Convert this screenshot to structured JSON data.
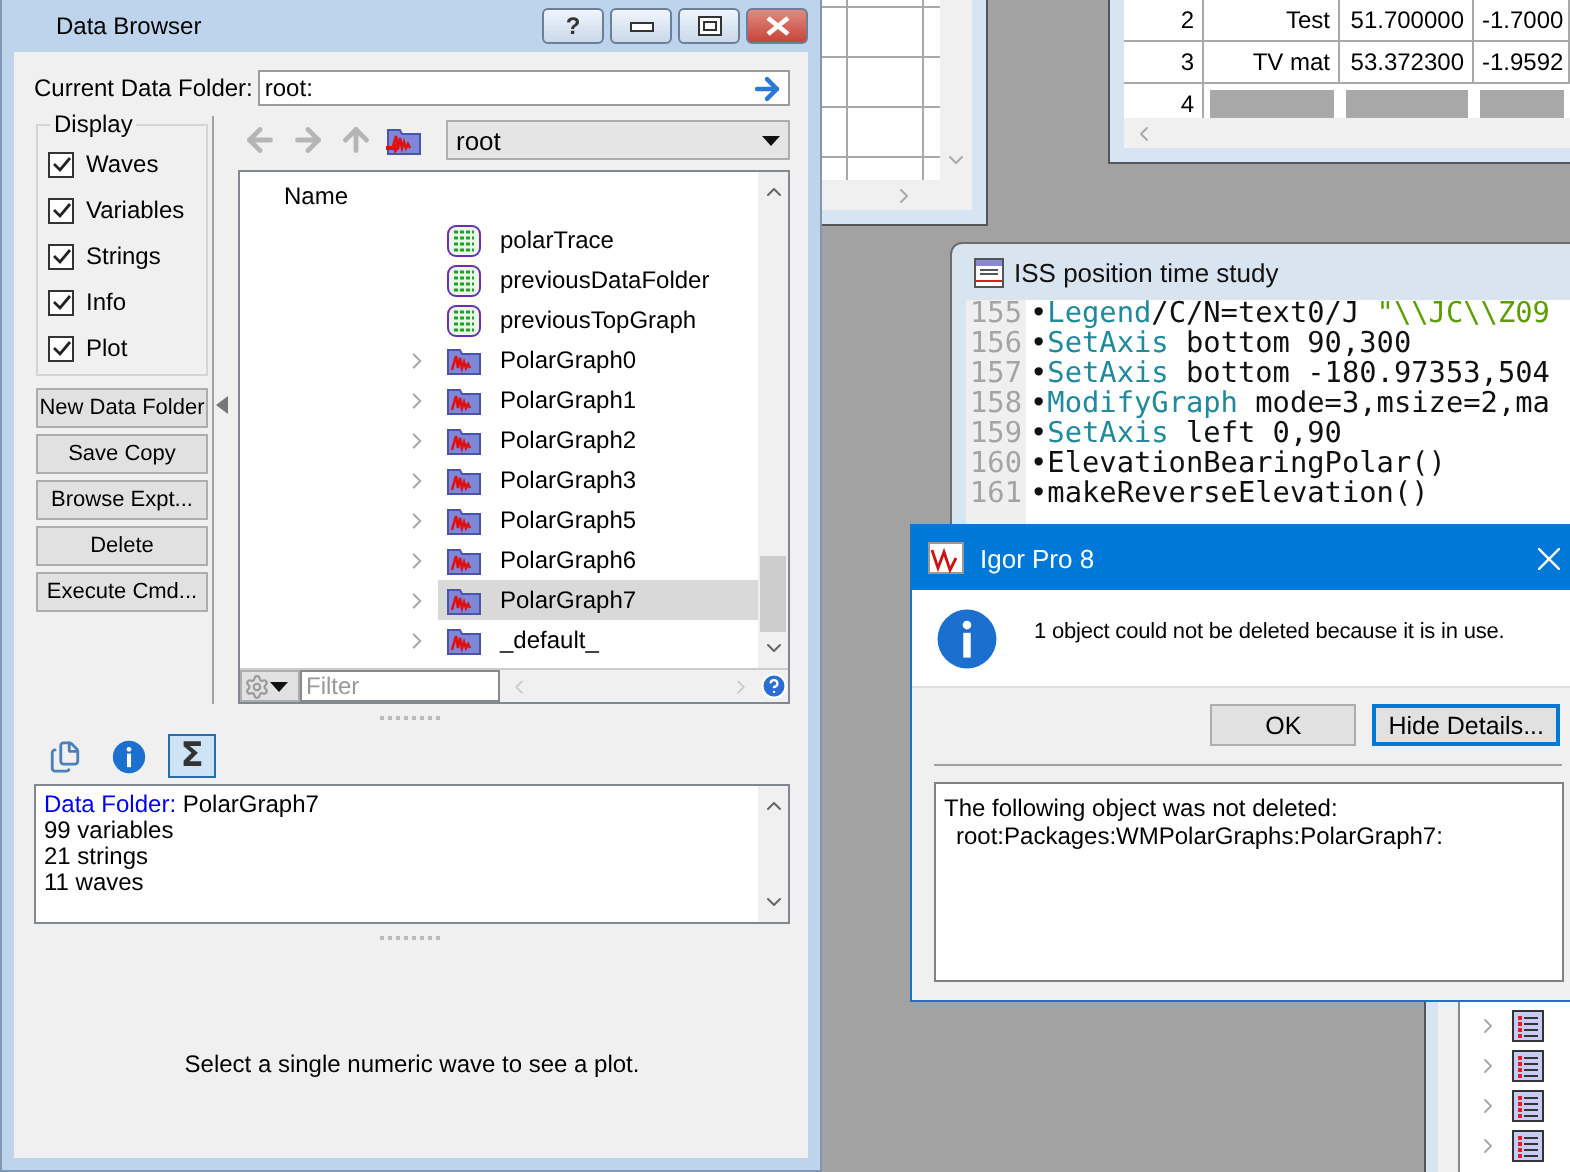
{
  "data_browser": {
    "title": "Data Browser",
    "help_label": "?",
    "folder_label": "Current Data Folder:",
    "folder_path": "root:",
    "display": {
      "title": "Display",
      "options": [
        {
          "label": "Waves",
          "checked": true
        },
        {
          "label": "Variables",
          "checked": true
        },
        {
          "label": "Strings",
          "checked": true
        },
        {
          "label": "Info",
          "checked": true
        },
        {
          "label": "Plot",
          "checked": true
        }
      ]
    },
    "buttons": [
      "New Data Folder",
      "Save Copy",
      "Browse Expt...",
      "Delete",
      "Execute Cmd..."
    ],
    "folder_menu": "root",
    "list": {
      "column": "Name",
      "items": [
        {
          "name": "polarTrace",
          "kind": "string",
          "selected": false
        },
        {
          "name": "previousDataFolder",
          "kind": "string",
          "selected": false
        },
        {
          "name": "previousTopGraph",
          "kind": "string",
          "selected": false
        },
        {
          "name": "PolarGraph0",
          "kind": "folder",
          "selected": false
        },
        {
          "name": "PolarGraph1",
          "kind": "folder",
          "selected": false
        },
        {
          "name": "PolarGraph2",
          "kind": "folder",
          "selected": false
        },
        {
          "name": "PolarGraph3",
          "kind": "folder",
          "selected": false
        },
        {
          "name": "PolarGraph5",
          "kind": "folder",
          "selected": false
        },
        {
          "name": "PolarGraph6",
          "kind": "folder",
          "selected": false
        },
        {
          "name": "PolarGraph7",
          "kind": "folder",
          "selected": true
        },
        {
          "name": "_default_",
          "kind": "folder",
          "selected": false
        }
      ]
    },
    "filter_placeholder": "Filter",
    "info_tabs": [
      {
        "kind": "copy",
        "selected": false
      },
      {
        "kind": "info",
        "selected": false
      },
      {
        "kind": "sum",
        "label": "Σ",
        "selected": true
      }
    ],
    "info": {
      "folder_label": "Data Folder:",
      "folder_name": "PolarGraph7",
      "lines": [
        "99 variables",
        "21 strings",
        "11 waves"
      ]
    },
    "plot_message": "Select a single numeric wave to see a plot."
  },
  "table_window": {
    "rows": [
      {
        "cells": [
          "2",
          "Test",
          "51.700000",
          "-1.7000"
        ]
      },
      {
        "cells": [
          "3",
          "TV mat",
          "53.372300",
          "-1.9592"
        ]
      },
      {
        "cells": [
          "4"
        ]
      }
    ]
  },
  "procedure_window": {
    "title": "ISS position time study",
    "lines": [
      {
        "number": "155",
        "segments": [
          {
            "kind": "plain",
            "text": "•"
          },
          {
            "kind": "keyword",
            "text": "Legend"
          },
          {
            "kind": "plain",
            "text": "/C/N=text0/J "
          },
          {
            "kind": "string",
            "text": "\"\\\\JC\\\\Z09"
          }
        ]
      },
      {
        "number": "156",
        "segments": [
          {
            "kind": "plain",
            "text": "•"
          },
          {
            "kind": "keyword",
            "text": "SetAxis"
          },
          {
            "kind": "plain",
            "text": " bottom 90,300"
          }
        ]
      },
      {
        "number": "157",
        "segments": [
          {
            "kind": "plain",
            "text": "•"
          },
          {
            "kind": "keyword",
            "text": "SetAxis"
          },
          {
            "kind": "plain",
            "text": " bottom -180.97353,504"
          }
        ]
      },
      {
        "number": "158",
        "segments": [
          {
            "kind": "plain",
            "text": "•"
          },
          {
            "kind": "keyword",
            "text": "ModifyGraph"
          },
          {
            "kind": "plain",
            "text": " mode=3,msize=2,ma"
          }
        ]
      },
      {
        "number": "159",
        "segments": [
          {
            "kind": "plain",
            "text": "•"
          },
          {
            "kind": "keyword",
            "text": "SetAxis"
          },
          {
            "kind": "plain",
            "text": " left 0,90"
          }
        ]
      },
      {
        "number": "160",
        "segments": [
          {
            "kind": "plain",
            "text": "•ElevationBearingPolar()"
          }
        ]
      },
      {
        "number": "161",
        "segments": [
          {
            "kind": "plain",
            "text": "•makeReverseElevation()"
          }
        ]
      }
    ]
  },
  "dialog": {
    "title": "Igor Pro 8",
    "message": "1 object could not be deleted because it is in use.",
    "buttons": [
      {
        "label": "OK",
        "default": false
      },
      {
        "label": "Hide Details...",
        "default": true
      }
    ],
    "details": {
      "heading": "The following object was not deleted:",
      "path": "root:Packages:WMPolarGraphs:PolarGraph7:"
    }
  }
}
